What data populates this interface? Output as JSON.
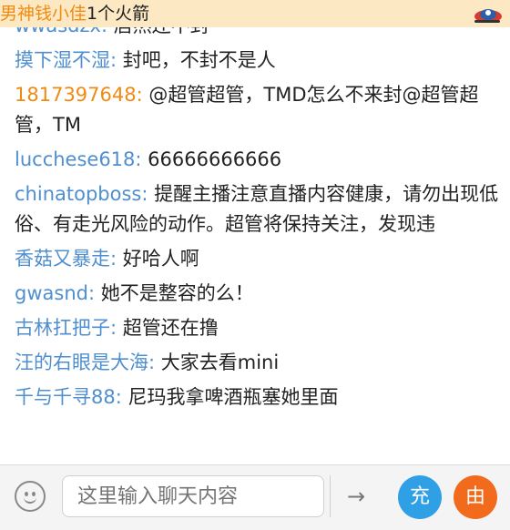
{
  "banner": {
    "name": "男神钱小佳",
    "gift_text": "1个火箭",
    "icon": "rocket-icon"
  },
  "messages": [
    {
      "user": "wwasdzx:",
      "text": "居然还不封",
      "user_color": "blue"
    },
    {
      "user": "摸下湿不湿:",
      "text": "封吧，不封不是人",
      "user_color": "blue"
    },
    {
      "user": "1817397648:",
      "text": "@超管超管，TMD怎么不来封@超管超管，TM",
      "user_color": "orange"
    },
    {
      "user": "lucchese618:",
      "text": "66666666666",
      "user_color": "blue"
    },
    {
      "user": "chinatopboss:",
      "text": "提醒主播注意直播内容健康，请勿出现低俗、有走光风险的动作。超管将保持关注，发现违",
      "user_color": "blue"
    },
    {
      "user": "香菇又暴走:",
      "text": "好哈人啊",
      "user_color": "blue"
    },
    {
      "user": "gwasnd:",
      "text": "她不是整容的么！",
      "user_color": "blue"
    },
    {
      "user": "古林扛把子:",
      "text": "超管还在撸",
      "user_color": "blue"
    },
    {
      "user": "汪的右眼是大海:",
      "text": "大家去看mini",
      "user_color": "blue"
    },
    {
      "user": "千与千寻88:",
      "text": "尼玛我拿啤酒瓶塞她里面",
      "user_color": "blue"
    }
  ],
  "input": {
    "placeholder": "这里输入聊天内容"
  },
  "buttons": {
    "send_symbol": "→",
    "charge_label": "充",
    "gift_label": "由"
  },
  "colors": {
    "username_blue": "#4f8fcf",
    "username_orange": "#f08a12",
    "banner_bg": "#fce9c4",
    "charge_button": "#2f9fe6",
    "gift_button": "#f26a1b"
  }
}
